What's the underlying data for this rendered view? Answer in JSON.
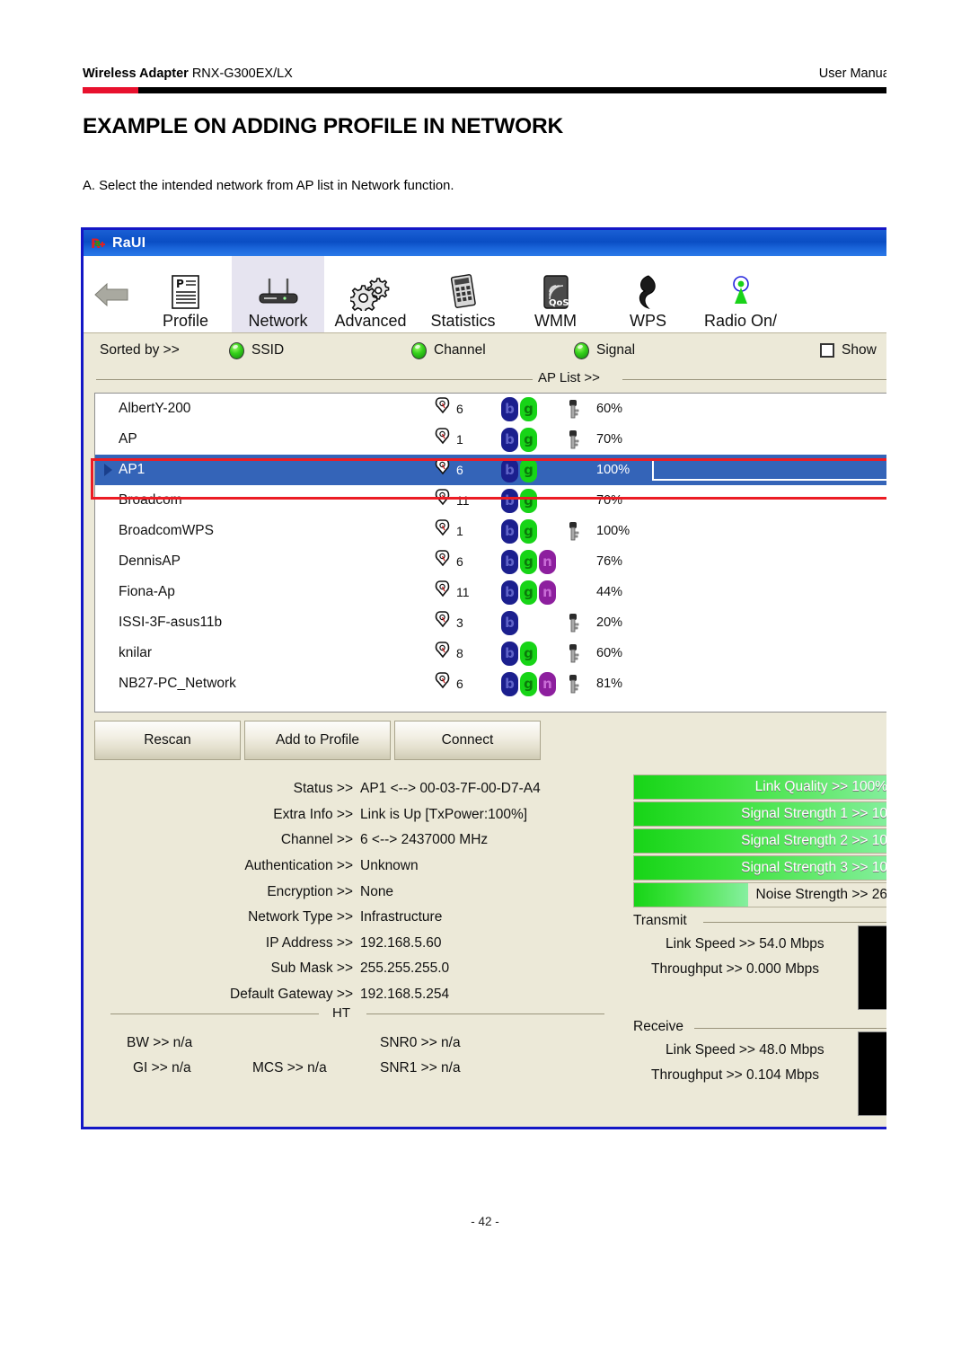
{
  "page": {
    "header_left_bold": "Wireless Adapter",
    "header_left_model": " RNX-G300EX/LX",
    "header_right": "User Manual",
    "title": "EXAMPLE ON ADDING PROFILE IN NETWORK",
    "intro": "A. Select the intended network from AP list in Network function.",
    "footer": "- 42 -",
    "accent_red": "#e8112d"
  },
  "app": {
    "titlebar": {
      "title": "RaUI",
      "icon": "raui-logo-icon"
    },
    "toolbar": {
      "back_icon": "back-arrow-icon",
      "items": [
        {
          "label": "Profile",
          "icon": "profile-document-icon",
          "selected": false
        },
        {
          "label": "Network",
          "icon": "router-icon",
          "selected": true
        },
        {
          "label": "Advanced",
          "icon": "gears-icon",
          "selected": false
        },
        {
          "label": "Statistics",
          "icon": "calculator-icon",
          "selected": false
        },
        {
          "label": "WMM",
          "icon": "qos-signal-icon",
          "selected": false
        },
        {
          "label": "WPS",
          "icon": "wps-swirl-icon",
          "selected": false
        },
        {
          "label": "Radio On/",
          "icon": "radio-antenna-icon",
          "selected": false
        }
      ]
    },
    "sortbar": {
      "label": "Sorted by >>",
      "options": [
        "SSID",
        "Channel",
        "Signal"
      ],
      "show_label": "Show",
      "show_checked": false
    },
    "aplist": {
      "caption": "AP List >>",
      "rows": [
        {
          "ssid": "AlbertY-200",
          "channel": "6",
          "modes": [
            "b",
            "g"
          ],
          "secured": true,
          "signal": "60%",
          "signal_pct": 60,
          "selected": false
        },
        {
          "ssid": "AP",
          "channel": "1",
          "modes": [
            "b",
            "g"
          ],
          "secured": true,
          "signal": "70%",
          "signal_pct": 70,
          "selected": false
        },
        {
          "ssid": "AP1",
          "channel": "6",
          "modes": [
            "b",
            "g"
          ],
          "secured": false,
          "signal": "100%",
          "signal_pct": 100,
          "selected": true
        },
        {
          "ssid": "Broadcom",
          "channel": "11",
          "modes": [
            "b",
            "g"
          ],
          "secured": false,
          "signal": "70%",
          "signal_pct": 70,
          "selected": false
        },
        {
          "ssid": "BroadcomWPS",
          "channel": "1",
          "modes": [
            "b",
            "g"
          ],
          "secured": true,
          "signal": "100%",
          "signal_pct": 100,
          "selected": false
        },
        {
          "ssid": "DennisAP",
          "channel": "6",
          "modes": [
            "b",
            "g",
            "n"
          ],
          "secured": false,
          "signal": "76%",
          "signal_pct": 76,
          "selected": false
        },
        {
          "ssid": "Fiona-Ap",
          "channel": "11",
          "modes": [
            "b",
            "g",
            "n"
          ],
          "secured": false,
          "signal": "44%",
          "signal_pct": 44,
          "selected": false
        },
        {
          "ssid": "ISSI-3F-asus11b",
          "channel": "3",
          "modes": [
            "b"
          ],
          "secured": true,
          "signal": "20%",
          "signal_pct": 20,
          "selected": false
        },
        {
          "ssid": "knilar",
          "channel": "8",
          "modes": [
            "b",
            "g"
          ],
          "secured": true,
          "signal": "60%",
          "signal_pct": 60,
          "selected": false
        },
        {
          "ssid": "NB27-PC_Network",
          "channel": "6",
          "modes": [
            "b",
            "g",
            "n"
          ],
          "secured": true,
          "signal": "81%",
          "signal_pct": 81,
          "selected": false
        }
      ]
    },
    "buttons": [
      "Rescan",
      "Add to Profile",
      "Connect"
    ],
    "status": {
      "lines": [
        {
          "key": "Status >>",
          "value": "AP1 <--> 00-03-7F-00-D7-A4"
        },
        {
          "key": "Extra Info >>",
          "value": "Link is Up [TxPower:100%]"
        },
        {
          "key": "Channel >>",
          "value": "6 <--> 2437000 MHz"
        },
        {
          "key": "Authentication >>",
          "value": "Unknown"
        },
        {
          "key": "Encryption >>",
          "value": "None"
        },
        {
          "key": "Network Type >>",
          "value": "Infrastructure"
        },
        {
          "key": "IP Address >>",
          "value": "192.168.5.60"
        },
        {
          "key": "Sub Mask >>",
          "value": "255.255.255.0"
        },
        {
          "key": "Default Gateway >>",
          "value": "192.168.5.254"
        }
      ],
      "ht_caption": "HT",
      "ht": {
        "bw": "BW >> n/a",
        "gi": "GI >> n/a",
        "mcs": "MCS >> n/a",
        "snr0": "SNR0 >> n/a",
        "snr1": "SNR1 >> n/a"
      }
    },
    "meters": [
      {
        "label": "Link Quality >> 100%",
        "fill_pct": 100,
        "dark_text": false
      },
      {
        "label": "Signal Strength 1 >> 10",
        "fill_pct": 100,
        "dark_text": false
      },
      {
        "label": "Signal Strength 2 >> 10",
        "fill_pct": 100,
        "dark_text": false
      },
      {
        "label": "Signal Strength 3 >> 10",
        "fill_pct": 100,
        "dark_text": false
      },
      {
        "label": "Noise Strength >> 26",
        "fill_pct": 44,
        "dark_text": true
      }
    ],
    "transmit": {
      "title": "Transmit",
      "link_speed": "Link Speed >>  54.0 Mbps",
      "throughput": "Throughput >> 0.000 Mbps"
    },
    "receive": {
      "title": "Receive",
      "link_speed": "Link Speed >>  48.0 Mbps",
      "throughput": "Throughput >> 0.104 Mbps"
    }
  }
}
